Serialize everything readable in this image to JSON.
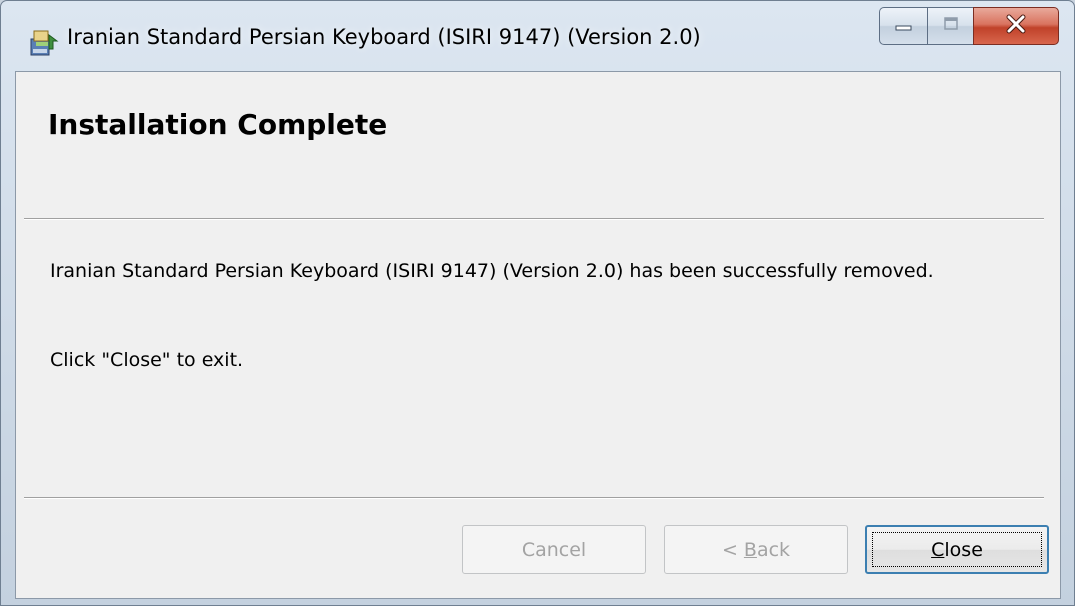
{
  "window": {
    "title": "Iranian Standard Persian Keyboard (ISIRI 9147) (Version 2.0)",
    "title_icon": "installer-package-icon",
    "controls": [
      "minimize-icon",
      "maximize-icon",
      "close-icon"
    ]
  },
  "header": {
    "heading": "Installation Complete"
  },
  "body": {
    "message": "Iranian Standard Persian Keyboard (ISIRI 9147) (Version 2.0) has been successfully removed.",
    "instruction": "Click \"Close\" to exit."
  },
  "buttons": {
    "cancel": {
      "label": "Cancel",
      "enabled": false
    },
    "back": {
      "prefix": "< ",
      "accesskey": "B",
      "rest": "ack",
      "enabled": false
    },
    "close": {
      "accesskey": "C",
      "rest": "lose",
      "enabled": true,
      "focused": true
    }
  },
  "colors": {
    "close_button_red": "#c0422a",
    "focus_border": "#3c7fb1",
    "disabled_text": "#a3a3a3"
  }
}
